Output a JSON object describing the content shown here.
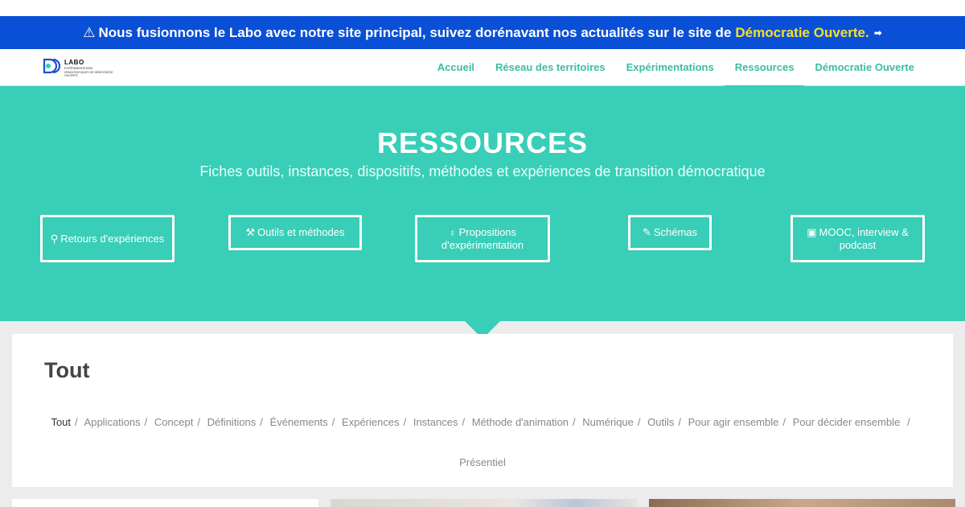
{
  "banner": {
    "icon": "warning-icon",
    "text": "Nous fusionnons le Labo avec notre site principal, suivez dorénavant nos actualités sur le site de",
    "link": "Démocratie Ouverte.",
    "arrow_icon": "arrow-right-icon"
  },
  "logo": {
    "title": "LABO",
    "subtitle": "EXPÉRIMENTATIONS DÉMOCRATIQUES DE DÉMOCRATIE OUVERTE"
  },
  "nav": {
    "items": [
      {
        "label": "Accueil"
      },
      {
        "label": "Réseau des territoires"
      },
      {
        "label": "Expérimentations"
      },
      {
        "label": "Ressources"
      },
      {
        "label": "Démocratie Ouverte"
      }
    ],
    "active": "Ressources"
  },
  "hero": {
    "title": "RESSOURCES",
    "subtitle": "Fiches outils, instances, dispositifs, méthodes et expériences de transition démocratique",
    "buttons": [
      {
        "icon": "map-marker-icon",
        "glyph": "⚲",
        "label": "Retours d'expériences"
      },
      {
        "icon": "tools-icon",
        "glyph": "⚒",
        "label": "Outils et méthodes"
      },
      {
        "icon": "lightbulb-icon",
        "glyph": "♁",
        "label": "Propositions d'expérimentation"
      },
      {
        "icon": "pen-icon",
        "glyph": "✎",
        "label": "Schémas"
      },
      {
        "icon": "ticket-icon",
        "glyph": "▣",
        "label": "MOOC, interview & podcast"
      }
    ]
  },
  "filter_section": {
    "title": "Tout",
    "filters": [
      "Tout",
      "Applications",
      "Concept",
      "Définitions",
      "Événements",
      "Expériences",
      "Instances",
      "Méthode d'animation",
      "Numérique",
      "Outils",
      "Pour agir ensemble",
      "Pour décider ensemble",
      "Présentiel"
    ],
    "active": "Tout",
    "separator": "/"
  },
  "colors": {
    "banner": "#0a50d6",
    "banner_link": "#f7e02a",
    "accent": "#38ceb7",
    "nav_text": "#3bbd9f"
  }
}
